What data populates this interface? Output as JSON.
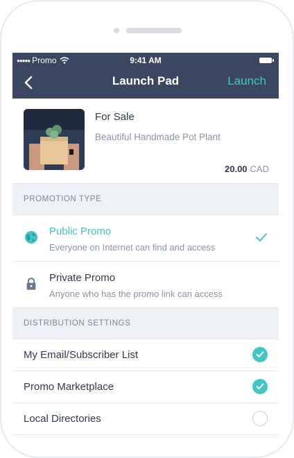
{
  "status_bar": {
    "carrier": "Promo",
    "time": "9:41 AM"
  },
  "nav": {
    "title": "Launch Pad",
    "action": "Launch",
    "back_icon": "chevron-left-icon"
  },
  "product": {
    "title": "For Sale",
    "description": "Beautiful Handmade Pot Plant",
    "price": "20.00",
    "currency": "CAD"
  },
  "promotion_type": {
    "header": "PROMOTION TYPE",
    "options": [
      {
        "title": "Public Promo",
        "subtitle": "Everyone on Internet can find and access",
        "icon": "globe-icon",
        "selected": true
      },
      {
        "title": "Private Promo",
        "subtitle": "Anyone who has the promo link can access",
        "icon": "lock-icon",
        "selected": false
      }
    ]
  },
  "distribution": {
    "header": "DISTRIBUTION SETTINGS",
    "items": [
      {
        "label": "My Email/Subscriber List",
        "checked": true
      },
      {
        "label": "Promo Marketplace",
        "checked": true
      },
      {
        "label": "Local Directories",
        "checked": false
      }
    ]
  },
  "colors": {
    "header_bg": "#3b4761",
    "accent": "#43c4c5",
    "text_primary": "#2f3a4e",
    "text_secondary": "#8a94a8",
    "section_bg": "#eef1f5"
  }
}
